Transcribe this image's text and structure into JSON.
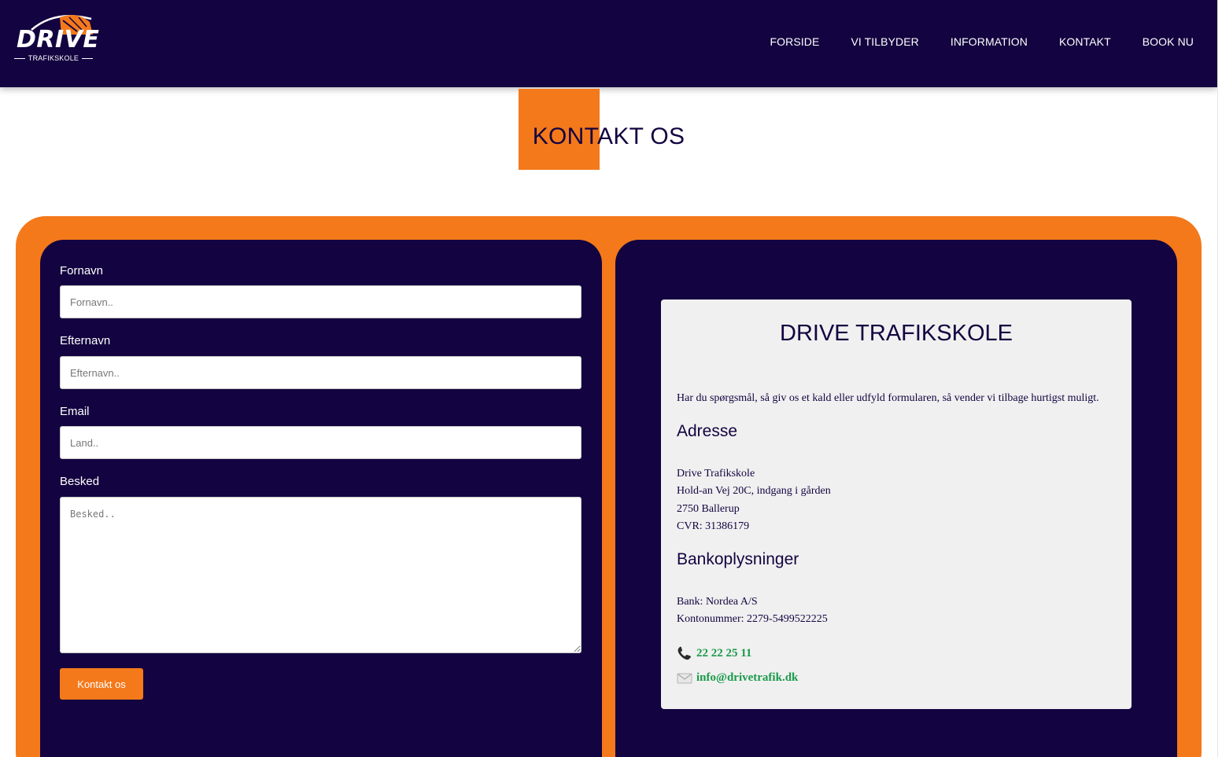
{
  "logo": {
    "word": "DRIVE",
    "sub": "TRAFIKSKOLE"
  },
  "nav": [
    "FORSIDE",
    "VI TILBYDER",
    "INFORMATION",
    "KONTAKT",
    "BOOK NU"
  ],
  "page_title": "KONTAKT OS",
  "form": {
    "first_name": {
      "label": "Fornavn",
      "placeholder": "Fornavn..",
      "value": ""
    },
    "last_name": {
      "label": "Efternavn",
      "placeholder": "Efternavn..",
      "value": ""
    },
    "email": {
      "label": "Email",
      "placeholder": "Land..",
      "value": ""
    },
    "message": {
      "label": "Besked",
      "placeholder": "Besked..",
      "value": ""
    },
    "submit_label": "Kontakt os"
  },
  "info": {
    "title": "DRIVE TRAFIKSKOLE",
    "intro": "Har du spørgsmål, så giv os et kald eller udfyld formularen, så vender vi tilbage hurtigst muligt.",
    "address_heading": "Adresse",
    "address_lines": [
      "Drive Trafikskole",
      "Hold-an Vej 20C, indgang i gården",
      "2750 Ballerup",
      "CVR: 31386179"
    ],
    "bank_heading": "Bankoplysninger",
    "bank_lines": [
      "Bank: Nordea A/S",
      "Kontonummer: 2279-5499522225"
    ],
    "phone": "22 22 25 11",
    "email": "info@drivetrafik.dk"
  },
  "colors": {
    "navy": "#130340",
    "orange": "#f4791b",
    "link_green": "#1a9a4a",
    "info_bg": "#f0f0f0"
  },
  "icons": [
    "phone-icon",
    "envelope-icon"
  ]
}
